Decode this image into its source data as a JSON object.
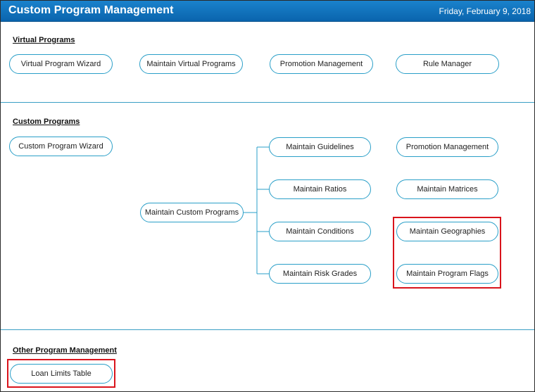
{
  "header": {
    "title": "Custom Program Management",
    "date": "Friday, February 9, 2018"
  },
  "virtual_programs": {
    "title": "Virtual Programs",
    "buttons": [
      "Virtual Program Wizard",
      "Maintain Virtual Programs",
      "Promotion Management",
      "Rule Manager"
    ]
  },
  "custom_programs": {
    "title": "Custom Programs",
    "wizard": "Custom Program Wizard",
    "maintain": "Maintain Custom Programs",
    "branches": [
      "Maintain Guidelines",
      "Maintain Ratios",
      "Maintain Conditions",
      "Maintain Risk Grades"
    ],
    "right": [
      "Promotion Management",
      "Maintain Matrices",
      "Maintain Geographies",
      "Maintain Program Flags"
    ]
  },
  "other_programs": {
    "title": "Other Program Management",
    "buttons": [
      "Loan Limits Table"
    ]
  },
  "colors": {
    "header": "#0a64ad",
    "pill_border": "#2a9fc8",
    "highlight": "#d9141c"
  }
}
